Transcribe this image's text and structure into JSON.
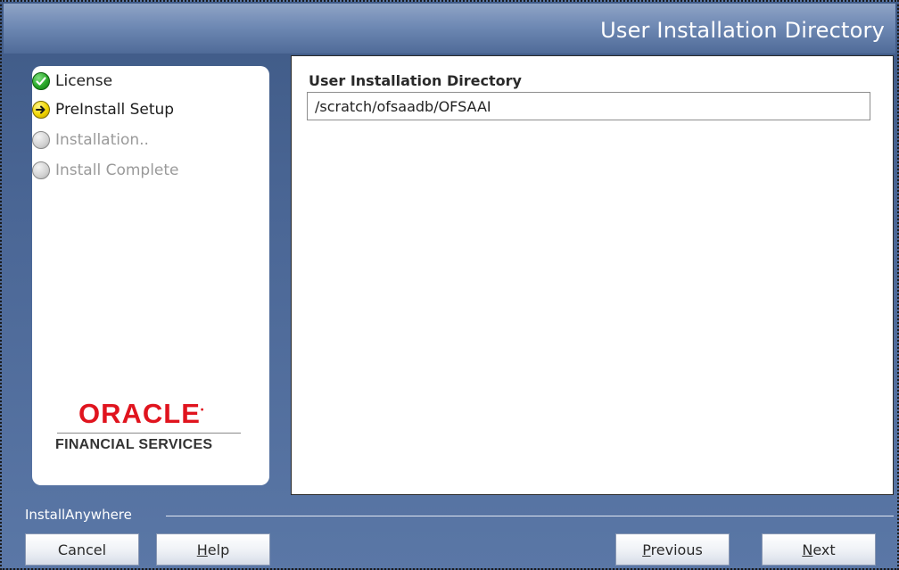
{
  "window": {
    "title": "User Installation Directory"
  },
  "sidebar": {
    "steps": [
      {
        "label": "License",
        "state": "done",
        "icon": "check-circle-icon"
      },
      {
        "label": "PreInstall Setup",
        "state": "current",
        "icon": "arrow-circle-icon"
      },
      {
        "label": "Installation..",
        "state": "pending",
        "icon": "empty-circle-icon"
      },
      {
        "label": "Install Complete",
        "state": "pending",
        "icon": "empty-circle-icon"
      }
    ],
    "logo": {
      "brand": "ORACLE",
      "subtitle": "FINANCIAL SERVICES"
    }
  },
  "main": {
    "field_label": "User Installation Directory",
    "field_value": "/scratch/ofsaadb/OFSAAI"
  },
  "footer": {
    "vendor_label": "InstallAnywhere",
    "buttons": {
      "cancel": "Cancel",
      "help_prefix": "",
      "help_underlined": "H",
      "help_rest": "elp",
      "previous_underlined": "P",
      "previous_rest": "revious",
      "next_underlined": "N",
      "next_rest": "ext"
    }
  },
  "colors": {
    "accent_red": "#e0141e",
    "frame_blue": "#4b6796"
  }
}
